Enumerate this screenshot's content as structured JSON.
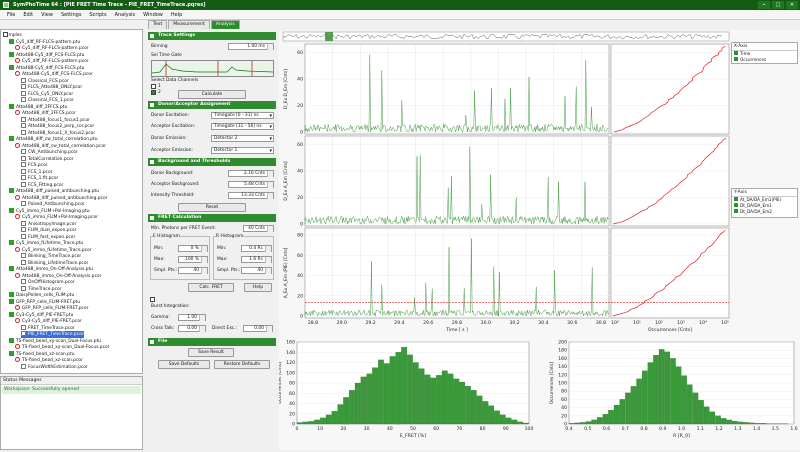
{
  "window": {
    "title": "SymPhoTime 64 : [PIE FRET Time Trace - PIE_FRET_TimeTrace.pqres]",
    "buttons": [
      "–",
      "□",
      "✕"
    ]
  },
  "menu": [
    "File",
    "Edit",
    "View",
    "Settings",
    "Scripts",
    "Analysis",
    "Window",
    "Help"
  ],
  "tabs": [
    "Text",
    "Measurement",
    "Analysis"
  ],
  "tree": [
    {
      "t": "Samples",
      "d": 0,
      "ic": "chk"
    },
    {
      "t": "Cy5_diff_RF-FLCS-pattern.ptu",
      "d": 1,
      "ic": "green"
    },
    {
      "t": "Cy5_diff_RF-FLCS-pattern.pcor",
      "d": 2,
      "ic": "red"
    },
    {
      "t": "Atto488-Cy5_diff_FCS-FLCS.ptu",
      "d": 1,
      "ic": "green"
    },
    {
      "t": "Cy5_diff_RF-FLCS-pattern.pcor",
      "d": 2,
      "ic": "red"
    },
    {
      "t": "Atto488-Cy5_diff_FCS-FLCS.ptu",
      "d": 1,
      "ic": "green"
    },
    {
      "t": "Atto488-Cy5_diff_FCS-FLCS.pcor",
      "d": 2,
      "ic": "red"
    },
    {
      "t": "Classical_FCS.pcor",
      "d": 3,
      "ic": "doc"
    },
    {
      "t": "FLCS_Atto488_ONLY.pcor",
      "d": 3,
      "ic": "doc"
    },
    {
      "t": "FLCS_Cy5_ONLY.pcor",
      "d": 3,
      "ic": "doc"
    },
    {
      "t": "Classical_FCS_1.pcor",
      "d": 3,
      "ic": "doc"
    },
    {
      "t": "Atto488_diff_2FFCS.ptu",
      "d": 1,
      "ic": "green"
    },
    {
      "t": "Atto488_diff_2FFCS.pcor",
      "d": 2,
      "ic": "red"
    },
    {
      "t": "Atto488_focus1_focus1.pcor",
      "d": 3,
      "ic": "doc"
    },
    {
      "t": "Atto488_focus2_perp_cor.pcor",
      "d": 3,
      "ic": "doc"
    },
    {
      "t": "Atto488_focus1_X_focus2.pcor",
      "d": 3,
      "ic": "doc"
    },
    {
      "t": "Atto488_diff_cw_total_correlation.ptu",
      "d": 1,
      "ic": "green"
    },
    {
      "t": "Atto488_diff_cw_total_correlation.pcor",
      "d": 2,
      "ic": "red"
    },
    {
      "t": "CW_Antibunching.pcor",
      "d": 3,
      "ic": "doc"
    },
    {
      "t": "TotalCorrelation.pcor",
      "d": 3,
      "ic": "doc"
    },
    {
      "t": "FCS.pcor",
      "d": 3,
      "ic": "doc"
    },
    {
      "t": "FCS_1.pcor",
      "d": 3,
      "ic": "doc"
    },
    {
      "t": "FCS_1.fit.pcor",
      "d": 3,
      "ic": "doc"
    },
    {
      "t": "FCS_Fitting.pcor",
      "d": 3,
      "ic": "doc"
    },
    {
      "t": "Atto488_diff_pulsed_antibunching.ptu",
      "d": 1,
      "ic": "green"
    },
    {
      "t": "Atto488_diff_pulsed_antibunching.pcor",
      "d": 2,
      "ic": "red"
    },
    {
      "t": "Pulsed_Antibunching.pcor",
      "d": 3,
      "ic": "doc"
    },
    {
      "t": "Cy5_immo_FLIM+Pol-Imaging.ptu",
      "d": 1,
      "ic": "green"
    },
    {
      "t": "Cy5_immo_FLIM+Pol-Imaging.pcor",
      "d": 2,
      "ic": "red"
    },
    {
      "t": "Anisotropylmage.pcor",
      "d": 3,
      "ic": "doc"
    },
    {
      "t": "FLIM_dual_expon.pcor",
      "d": 3,
      "ic": "doc"
    },
    {
      "t": "FLIM_fast_expon.pcor",
      "d": 3,
      "ic": "doc"
    },
    {
      "t": "Cy5_immo_fLifetime_Trace.ptu",
      "d": 1,
      "ic": "green"
    },
    {
      "t": "Cy5_immo_fLifetime_Trace.pcor",
      "d": 2,
      "ic": "red"
    },
    {
      "t": "Blinking_TimeTrace.pcor",
      "d": 3,
      "ic": "doc"
    },
    {
      "t": "Blinking_LifetimeTrace.pcor",
      "d": 3,
      "ic": "doc"
    },
    {
      "t": "Atto488_immo_On-Off-Analysis.ptu",
      "d": 1,
      "ic": "green"
    },
    {
      "t": "Atto488_immo_On-Off-Analysis.pcor",
      "d": 2,
      "ic": "red"
    },
    {
      "t": "OnOffHistogram.pcor",
      "d": 3,
      "ic": "doc"
    },
    {
      "t": "TimeTrace.pcor",
      "d": 3,
      "ic": "doc"
    },
    {
      "t": "DaisyPollen_cells_FLIM.ptu",
      "d": 1,
      "ic": "green"
    },
    {
      "t": "GFP_RFP_cells_FLIM-FRET.ptu",
      "d": 1,
      "ic": "green"
    },
    {
      "t": "GFP_RFP_cells_FLIM-FRET.pcor",
      "d": 2,
      "ic": "red"
    },
    {
      "t": "Cy3-Cy5_diff_PIE-FRET.ptu",
      "d": 1,
      "ic": "green"
    },
    {
      "t": "Cy3-Cy5_diff_PIE-FRET.pcor",
      "d": 2,
      "ic": "red"
    },
    {
      "t": "FRET_TimeTrace.pcor",
      "d": 3,
      "ic": "doc"
    },
    {
      "t": "PIE_FRET_TimeTrace.pcor",
      "d": 3,
      "ic": "doc",
      "sel": true
    },
    {
      "t": "TS-fixed_bead_xy-scan_Dual-Focus.ptu",
      "d": 1,
      "ic": "green"
    },
    {
      "t": "TS-fixed_bead_xy-scan_Dual-Focus.pcor",
      "d": 2,
      "ic": "red"
    },
    {
      "t": "TS-fixed_bead_xz-scan.ptu",
      "d": 1,
      "ic": "green"
    },
    {
      "t": "TS-fixed_bead_xz-scan.pcor",
      "d": 2,
      "ic": "red"
    },
    {
      "t": "FocusWidthEstimation.pcor",
      "d": 3,
      "ic": "doc"
    }
  ],
  "status": {
    "header": "Status Messages",
    "message": "Workspace: Successfully opened"
  },
  "panel": {
    "trace_settings": "Trace Settings",
    "binning_label": "Binning",
    "binning_value": "1.00 ms",
    "sel_gate_label": "Sel Time Gate",
    "select_channels_label": "Select Data Channels",
    "channels": [
      "1",
      "2"
    ],
    "calculate": "Calculate",
    "donor_acceptor": "Donor/Acceptor Assignment",
    "donor_exc_label": "Donor Excitation:",
    "donor_exc_value": "Timegate [0 - 31] ns",
    "acc_exc_label": "Acceptor Excitation:",
    "acc_exc_value": "Timegate [31 - 56] ns",
    "donor_em_label": "Donor Emission:",
    "donor_em_value": "Detector 2",
    "acc_em_label": "Acceptor Emission:",
    "acc_em_value": "Detector 1",
    "bg_thresh": "Background and Thresholds",
    "donor_bg_label": "Donor Background:",
    "donor_bg_value": "2.16 Cnts",
    "acc_bg_label": "Acceptor Background:",
    "acc_bg_value": "5.48 Cnts",
    "int_thr_label": "Intensity Threshold:",
    "int_thr_value": "13.33 Cnts",
    "reset": "Reset",
    "fret_calc": "FRET Calculation",
    "min_photons_label": "Min. Photons per FRET Event:",
    "min_photons_value": "40 Cnts",
    "e_hist": "E Histogram",
    "r_hist": "R Histogram",
    "min_label": "Min:",
    "max_label": "Max:",
    "smpl_label": "Smpl. Pts.:",
    "e_min": "0 %",
    "e_max": "100 %",
    "e_smpl": "40",
    "r_min": "0.4 Rc",
    "r_max": "1.6 Rc",
    "r_smpl": "40",
    "calc_fret": "Calc. FRET",
    "help": "Help",
    "burst_integration": "Burst Integration:",
    "gamma_label": "Gamma:",
    "gamma_value": "1.00",
    "cross_talk_label": "Cross Talk:",
    "cross_talk_value": "0.00",
    "direct_exc_label": "Direct Exc.:",
    "direct_exc_value": "0.00",
    "file": "File",
    "save_result": "Save Result",
    "save_defaults": "Save Defaults",
    "restore_defaults": "Restore Defaults"
  },
  "xaxis_legend": {
    "title": "X-Axis",
    "items": [
      "Time",
      "Occurrences"
    ]
  },
  "yaxis_legend": {
    "title": "Y-Axis",
    "items": [
      "At_DA/DA_Em1(PIE)",
      "Dt_DA/DA_Em1",
      "Dt_DA/DA_Em2"
    ]
  },
  "colors": {
    "trace": "#2f8f2f",
    "cumulative": "#e02020",
    "threshold": "#e02020",
    "bars": "#3a9a3a"
  },
  "chart_data": [
    {
      "type": "line",
      "name": "Donor channel trace",
      "ylabel": "D_Ex D_Em [Cnts]",
      "yticks": [
        "0",
        "20",
        "40",
        "60"
      ],
      "ylim": [
        0,
        65
      ]
    },
    {
      "type": "line",
      "name": "Acceptor channel trace",
      "ylabel": "D_Ex A_Em [Cnts]",
      "yticks": [
        "0",
        "20",
        "40",
        "60"
      ],
      "ylim": [
        0,
        65
      ]
    },
    {
      "type": "line",
      "name": "PIE trace",
      "ylabel": "A_Ex A_Em (PIE) [Cnts]",
      "yticks": [
        "0",
        "20",
        "40",
        "60",
        "80"
      ],
      "ylim": [
        0,
        85
      ],
      "threshold": 13.33
    },
    {
      "type": "time_axis",
      "xlabel": "Time [ s ]",
      "xticks": [
        "28.8",
        "29.0",
        "29.2",
        "29.4",
        "29.6",
        "29.8",
        "30.0",
        "30.2",
        "30.4",
        "30.6",
        "30.8"
      ]
    },
    {
      "type": "occurrence_axis",
      "xlabel": "Occurrences [Cnts]",
      "xticks": [
        "10⁰",
        "10¹",
        "10²",
        "10³",
        "10⁴",
        "10⁵"
      ]
    },
    {
      "type": "bar",
      "xlabel": "E_FRET [%]",
      "ylabel": "Occurrences [Cnts]",
      "xticks": [
        "0",
        "10",
        "20",
        "30",
        "40",
        "50",
        "60",
        "70",
        "80",
        "90",
        "100"
      ],
      "yticks": [
        "0",
        "20",
        "40",
        "60",
        "80",
        "100",
        "120",
        "140",
        "160"
      ],
      "values": [
        3,
        4,
        5,
        8,
        12,
        18,
        25,
        38,
        52,
        66,
        80,
        92,
        98,
        110,
        125,
        118,
        132,
        140,
        150,
        135,
        120,
        108,
        96,
        90,
        95,
        104,
        98,
        88,
        82,
        74,
        66,
        55,
        44,
        36,
        26,
        18,
        12,
        8,
        4,
        2
      ]
    },
    {
      "type": "bar",
      "xlabel": "R [R_0]",
      "ylabel": "Occurrences [Cnts]",
      "xticks": [
        "0.4",
        "0.5",
        "0.6",
        "0.7",
        "0.8",
        "0.9",
        "1.0",
        "1.1",
        "1.2",
        "1.3",
        "1.4",
        "1.5",
        "1.6"
      ],
      "yticks": [
        "0",
        "20",
        "40",
        "60",
        "80",
        "100",
        "120",
        "140",
        "160",
        "180",
        "200"
      ],
      "values": [
        2,
        3,
        4,
        6,
        10,
        16,
        24,
        34,
        46,
        60,
        76,
        92,
        110,
        130,
        150,
        168,
        182,
        176,
        160,
        140,
        118,
        96,
        76,
        58,
        42,
        30,
        20,
        14,
        10,
        7,
        5,
        4,
        3,
        2,
        2,
        1,
        1,
        1,
        1,
        0
      ]
    }
  ]
}
